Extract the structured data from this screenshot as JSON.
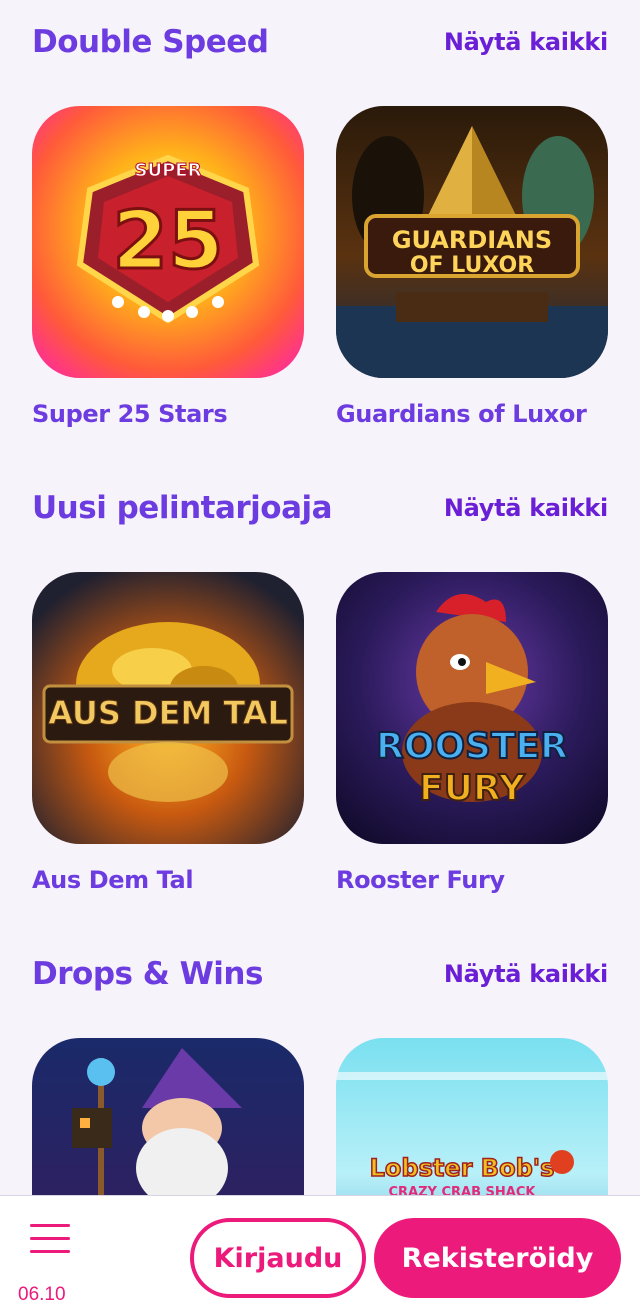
{
  "sections": [
    {
      "title": "Double Speed",
      "see_all": "Näytä kaikki",
      "games": [
        {
          "name": "Super 25 Stars",
          "art_text": "25",
          "art_sub": "SUPER"
        },
        {
          "name": "Guardians of Luxor",
          "art_text": "GUARDIANS",
          "art_sub": "OF LUXOR"
        }
      ]
    },
    {
      "title": "Uusi pelintarjoaja",
      "see_all": "Näytä kaikki",
      "games": [
        {
          "name": "Aus Dem Tal",
          "art_text": "AUS DEM TAL"
        },
        {
          "name": "Rooster Fury",
          "art_text": "ROOSTER",
          "art_sub": "FURY"
        }
      ]
    },
    {
      "title": "Drops & Wins",
      "see_all": "Näytä kaikki",
      "games": [
        {
          "name": "",
          "art_text": ""
        },
        {
          "name": "",
          "art_text": "Lobster Bob's",
          "art_sub": "CRAZY CRAB SHACK"
        }
      ]
    }
  ],
  "bottom_bar": {
    "date": "06.10",
    "login_label": "Kirjaudu",
    "register_label": "Rekisteröidy"
  },
  "colors": {
    "accent_purple": "#6c3ce0",
    "accent_pink": "#ec1a7a",
    "background": "#f6f3fb"
  },
  "icons": [
    "hamburger-menu-icon"
  ]
}
